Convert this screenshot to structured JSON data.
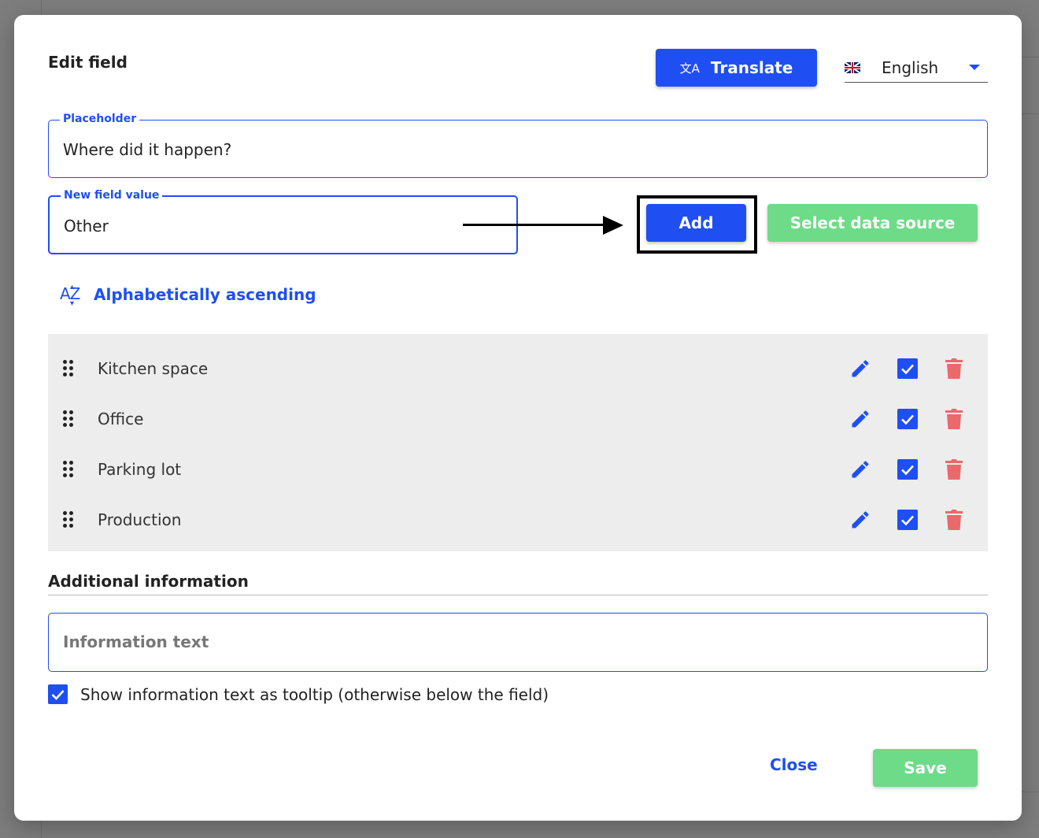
{
  "dialog": {
    "title": "Edit field",
    "translate_label": "Translate",
    "language": "English"
  },
  "placeholder_field": {
    "legend": "Placeholder",
    "value": "Where did it happen?"
  },
  "new_value_field": {
    "legend": "New field value",
    "value": "Other"
  },
  "buttons": {
    "add": "Add",
    "select_data_source": "Select data source",
    "close": "Close",
    "save": "Save"
  },
  "sort": {
    "label": "Alphabetically ascending",
    "icon": "sort-alpha-asc-icon"
  },
  "items": [
    {
      "label": "Kitchen space",
      "checked": true
    },
    {
      "label": "Office",
      "checked": true
    },
    {
      "label": "Parking lot",
      "checked": true
    },
    {
      "label": "Production",
      "checked": true
    }
  ],
  "additional": {
    "title": "Additional information",
    "info_placeholder": "Information text",
    "tooltip_label": "Show information text as tooltip (otherwise below the field)",
    "tooltip_checked": true
  },
  "colors": {
    "primary": "#1f4ff2",
    "success": "#6ddb88",
    "danger": "#e86a6a",
    "list_bg": "#ededed"
  }
}
